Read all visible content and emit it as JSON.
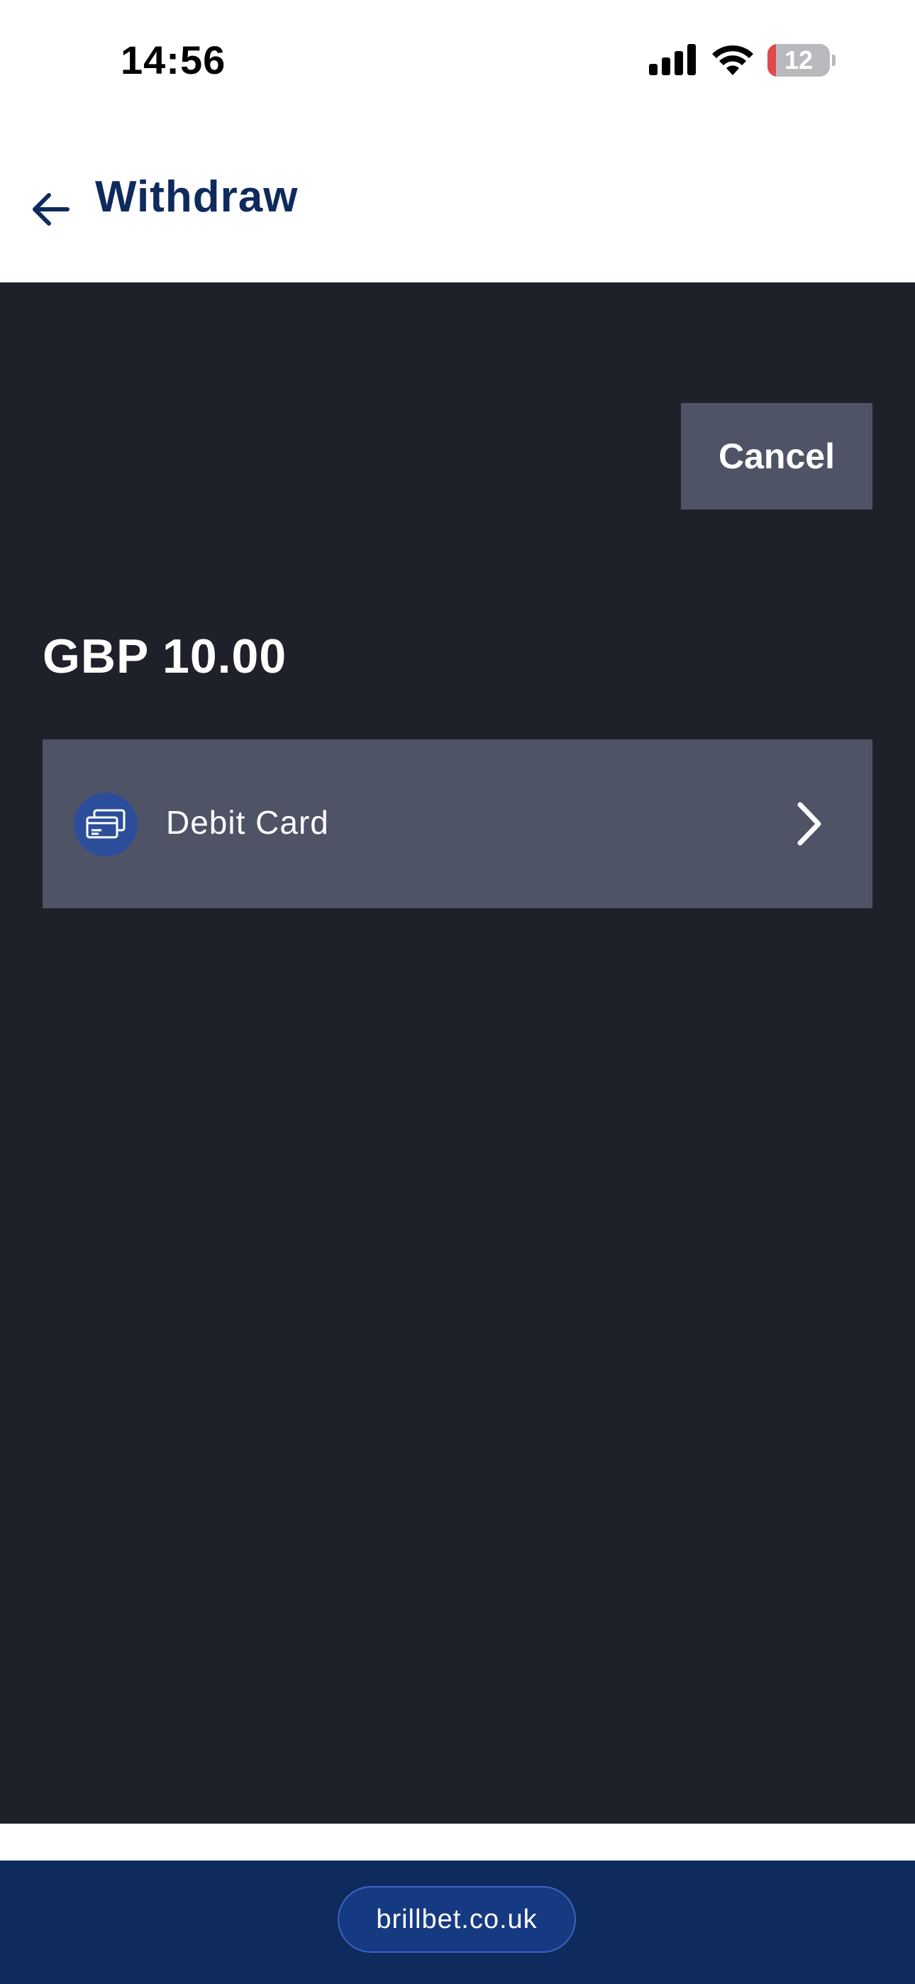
{
  "status_bar": {
    "time": "14:56",
    "battery_level": "12",
    "icons": [
      "cellular-signal-icon",
      "wifi-icon",
      "battery-icon"
    ]
  },
  "header": {
    "title": "Withdraw",
    "back_icon": "arrow-left-icon"
  },
  "withdraw": {
    "cancel_label": "Cancel",
    "amount": "GBP 10.00",
    "methods": [
      {
        "label": "Debit Card",
        "icon": "credit-card-icon",
        "chevron": "chevron-right-icon"
      }
    ]
  },
  "footer": {
    "url": "brillbet.co.uk"
  },
  "colors": {
    "header_text": "#0f2a5c",
    "content_background": "#1f212a",
    "button_background": "#4f5366",
    "method_icon_background": "#2c4e9a",
    "footer_background": "#0f2a5c",
    "battery_low": "#e04a4a"
  }
}
